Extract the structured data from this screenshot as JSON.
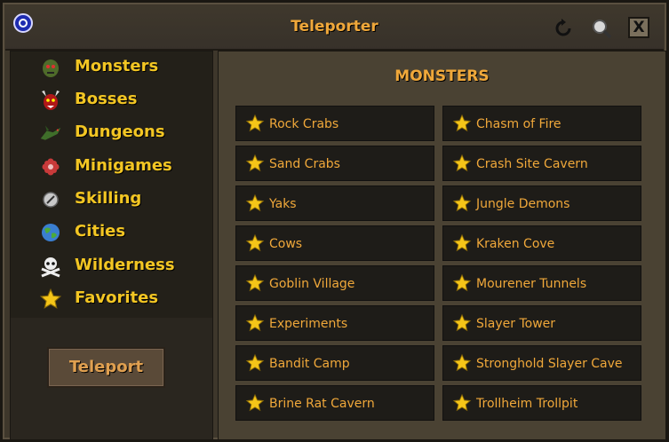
{
  "window": {
    "title": "Teleporter",
    "logo_icon": "pvp-logo-icon",
    "controls": [
      "refresh-icon",
      "search-icon",
      "close-icon"
    ],
    "close_label": "X"
  },
  "sidebar": {
    "items": [
      {
        "label": "Monsters",
        "icon": "ogre-head-icon"
      },
      {
        "label": "Bosses",
        "icon": "demon-head-icon"
      },
      {
        "label": "Dungeons",
        "icon": "dragon-icon"
      },
      {
        "label": "Minigames",
        "icon": "red-flower-icon"
      },
      {
        "label": "Skilling",
        "icon": "skill-orb-icon"
      },
      {
        "label": "Cities",
        "icon": "globe-icon"
      },
      {
        "label": "Wilderness",
        "icon": "skull-crossbones-icon"
      },
      {
        "label": "Favorites",
        "icon": "star-icon"
      }
    ],
    "teleport_button": "Teleport"
  },
  "main": {
    "section_title": "MONSTERS",
    "destinations_left": [
      "Rock Crabs",
      "Sand Crabs",
      "Yaks",
      "Cows",
      "Goblin Village",
      "Experiments",
      "Bandit Camp",
      "Brine Rat Cavern"
    ],
    "destinations_right": [
      "Chasm of Fire",
      "Crash Site Cavern",
      "Jungle Demons",
      "Kraken Cove",
      "Mourener Tunnels",
      "Slayer Tower",
      "Stronghold Slayer Cave",
      "Trollheim Trollpit"
    ]
  },
  "colors": {
    "accent": "#f0a83a",
    "menu_text": "#f3c623",
    "panel_bg": "#4a4233",
    "tile_bg": "#1e1c18"
  }
}
